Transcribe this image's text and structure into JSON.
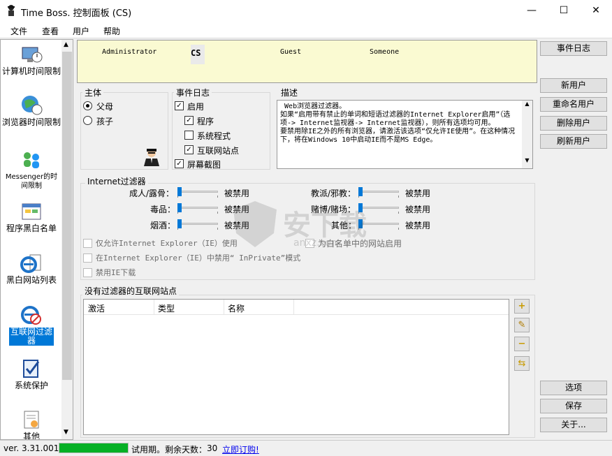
{
  "window": {
    "title": "Time Boss. 控制面板 (CS)",
    "minimize": "—",
    "maximize": "☐",
    "close": "✕"
  },
  "menu": [
    "文件",
    "查看",
    "用户",
    "帮助"
  ],
  "sidebar": {
    "items": [
      {
        "label": "计算机时间限制",
        "icon": "computer-clock-icon"
      },
      {
        "label": "浏览器时间限制",
        "icon": "globe-clock-icon"
      },
      {
        "label": "Messenger的时间限制",
        "icon": "messenger-icon"
      },
      {
        "label": "程序黑白名单",
        "icon": "program-list-icon"
      },
      {
        "label": "黑白网站列表",
        "icon": "ie-list-icon"
      },
      {
        "label": "互联网过滤器",
        "icon": "ie-filter-icon",
        "selected": true
      },
      {
        "label": "系统保护",
        "icon": "shield-check-icon"
      },
      {
        "label": "其他",
        "icon": "misc-icon"
      }
    ]
  },
  "users": [
    "Administrator",
    "CS",
    "Guest",
    "Someone"
  ],
  "selected_user": "CS",
  "subject": {
    "label": "主体",
    "options": [
      "父母",
      "孩子"
    ],
    "selected": "父母"
  },
  "eventlog": {
    "label": "事件日志",
    "items": [
      {
        "label": "启用",
        "checked": true
      },
      {
        "label": "程序",
        "checked": true
      },
      {
        "label": "系统程式",
        "checked": false
      },
      {
        "label": "互联网站点",
        "checked": true
      },
      {
        "label": "屏幕截图",
        "checked": true
      }
    ]
  },
  "description": {
    "label": "描述",
    "text": " Web浏览器过滤器。\n如果“启用带有禁止的单词和短语过滤器的Internet Explorer启用”（选项-> Internet监视器-> Internet监视器），则所有选项均可用。\n要禁用除IE之外的所有浏览器，请激活该选项“仅允许IE使用”。在这种情况下，将在Windows 10中启动IE而不是MS Edge。"
  },
  "filter": {
    "label": "Internet过滤器",
    "left": [
      {
        "name": "成人/露骨：",
        "value": 0,
        "state": "被禁用"
      },
      {
        "name": "毒品：",
        "value": 0,
        "state": "被禁用"
      },
      {
        "name": "烟酒：",
        "value": 0,
        "state": "被禁用"
      }
    ],
    "right": [
      {
        "name": "教派/邪教：",
        "value": 0,
        "state": "被禁用"
      },
      {
        "name": "赌博/赌场：",
        "value": 0,
        "state": "被禁用"
      },
      {
        "name": "其他：",
        "value": 0,
        "state": "被禁用"
      }
    ],
    "options": [
      "仅允许Internet Explorer（IE）使用",
      "为白名单中的网站启用",
      "在Internet Explorer（IE）中禁用“ InPrivate”模式",
      "禁用IE下载"
    ]
  },
  "sites": {
    "label": "没有过滤器的互联网站点",
    "columns": [
      "激活",
      "类型",
      "名称"
    ],
    "rows": []
  },
  "buttons": {
    "event_log": "事件日志",
    "new_user": "新用户",
    "rename_user": "重命名用户",
    "delete_user": "删除用户",
    "refresh_user": "刷新用户",
    "options": "选项",
    "save": "保存",
    "about": "关于..."
  },
  "tools": {
    "add": "+",
    "edit": "✎",
    "remove": "−",
    "move": "⇆"
  },
  "status": {
    "version": "ver. 3.31.001",
    "trial": "试用期。剩余天数：",
    "days": "30",
    "buy": "立即订购!",
    "trial_progress": 1.0
  },
  "colors": {
    "accent": "#0078d7",
    "progress": "#06b025",
    "selection": "#0078d7",
    "userbar": "#fafad2"
  }
}
